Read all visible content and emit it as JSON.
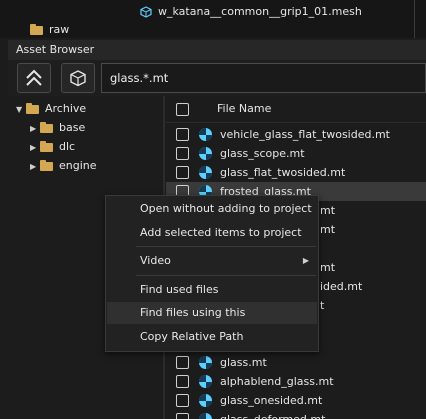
{
  "top_panel": {
    "mesh_item": "w_katana__common__grip1_01.mesh",
    "folder_item": "raw"
  },
  "asset_browser": {
    "title": "Asset Browser",
    "search_value": "glass.*.mt",
    "column_header": "File Name"
  },
  "tree": {
    "root": "Archive",
    "children": [
      "base",
      "dlc",
      "engine"
    ]
  },
  "files": [
    "vehicle_glass_flat_twosided.mt",
    "glass_scope.mt",
    "glass_flat_twosided.mt",
    "frosted_glass.mt",
    "",
    "",
    "",
    "",
    "",
    "",
    "",
    "glass.mt",
    "alphablend_glass.mt",
    "glass_onesided.mt",
    "glass_deformed.mt"
  ],
  "partial_names": {
    "r4": "mt",
    "r5": "mt",
    "r7": "mt",
    "r8": "ided.mt",
    "r9": "t"
  },
  "context_menu": {
    "items": {
      "open": "Open without adding to project",
      "add": "Add selected items to project",
      "video": "Video",
      "find_used": "Find used files",
      "find_using": "Find files using this",
      "copy_path": "Copy Relative Path"
    }
  },
  "colors": {
    "accent_icon": "#5bd0ff",
    "folder": "#d4a853",
    "background": "#1c1c1c"
  }
}
